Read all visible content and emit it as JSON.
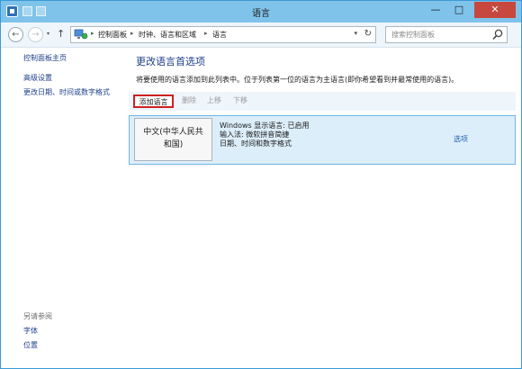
{
  "window": {
    "title": "语言"
  },
  "titlebar": {
    "minimize": "—",
    "maximize": "□",
    "close": "✕"
  },
  "nav": {
    "back": "←",
    "forward": "→",
    "history": "▾",
    "up": "↑",
    "breadcrumbs": [
      "控制面板",
      "时钟、语言和区域",
      "语言"
    ],
    "separator": "▸",
    "dropdown": "▾",
    "refresh": "↻",
    "search_placeholder": "搜索控制面板"
  },
  "sidebar": {
    "home_link": "控制面板主页",
    "links": [
      "高级设置",
      "更改日期、时间或数字格式"
    ],
    "see_also_heading": "另请参阅",
    "see_also": [
      "字体",
      "位置"
    ]
  },
  "main": {
    "title": "更改语言首选项",
    "description": "将要使用的语言添加到此列表中。位于列表第一位的语言为主语言(即你希望看到并最常使用的语言)。",
    "toolbar": {
      "add": "添加语言",
      "remove": "删除",
      "move_up": "上移",
      "move_down": "下移"
    },
    "languages": [
      {
        "name_line1": "中文(中华人民共",
        "name_line2": "和国)",
        "info": [
          "Windows 显示语言: 已启用",
          "输入法: 微软拼音简捷",
          "日期、时间和数字格式"
        ],
        "options": "选项"
      }
    ]
  },
  "colors": {
    "accent": "#7fc3ea",
    "highlight": "#cf2020",
    "link": "#1e3f8a",
    "selection": "#dceefa"
  }
}
